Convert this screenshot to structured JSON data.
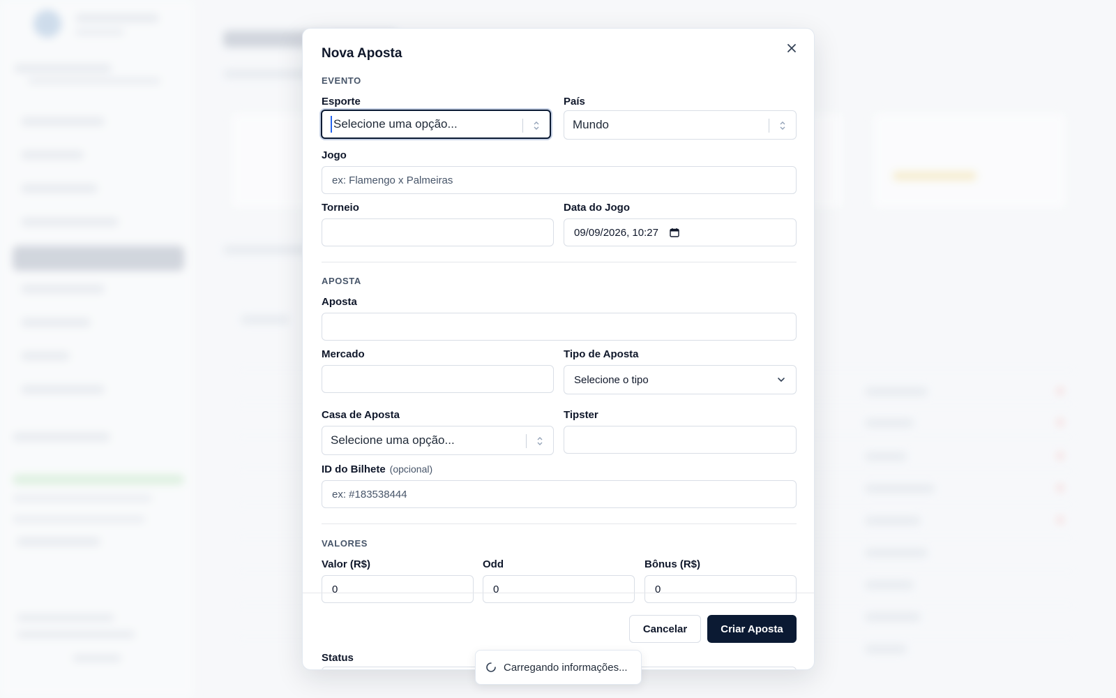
{
  "modal": {
    "title": "Nova Aposta",
    "close_icon": "close-icon"
  },
  "evento": {
    "section_title": "EVENTO",
    "esporte": {
      "label": "Esporte",
      "value": "Selecione uma opção..."
    },
    "pais": {
      "label": "País",
      "value": "Mundo"
    },
    "jogo": {
      "label": "Jogo",
      "placeholder": "ex: Flamengo x Palmeiras"
    },
    "torneio": {
      "label": "Torneio",
      "value": ""
    },
    "data_jogo": {
      "label": "Data do Jogo",
      "value": "09/09/2026, 10:27",
      "icon": "calendar-icon"
    }
  },
  "aposta": {
    "section_title": "APOSTA",
    "aposta": {
      "label": "Aposta",
      "value": ""
    },
    "mercado": {
      "label": "Mercado",
      "value": ""
    },
    "tipo": {
      "label": "Tipo de Aposta",
      "value": "Selecione o tipo"
    },
    "casa": {
      "label": "Casa de Aposta",
      "value": "Selecione uma opção..."
    },
    "tipster": {
      "label": "Tipster",
      "value": ""
    },
    "bilhete": {
      "label": "ID do Bilhete",
      "optional": "(opcional)",
      "placeholder": "ex: #183538444"
    }
  },
  "valores": {
    "section_title": "VALORES",
    "valor": {
      "label": "Valor (R$)",
      "value": "0"
    },
    "odd": {
      "label": "Odd",
      "value": "0"
    },
    "bonus": {
      "label": "Bônus (R$)",
      "value": "0"
    },
    "status": {
      "label": "Status"
    }
  },
  "footer": {
    "cancel_label": "Cancelar",
    "submit_label": "Criar Aposta"
  },
  "toast": {
    "text": "Carregando informações..."
  },
  "colors": {
    "primary": "#0b1a33",
    "focus_ring": "#c7d2e6",
    "caret": "#2563eb"
  }
}
